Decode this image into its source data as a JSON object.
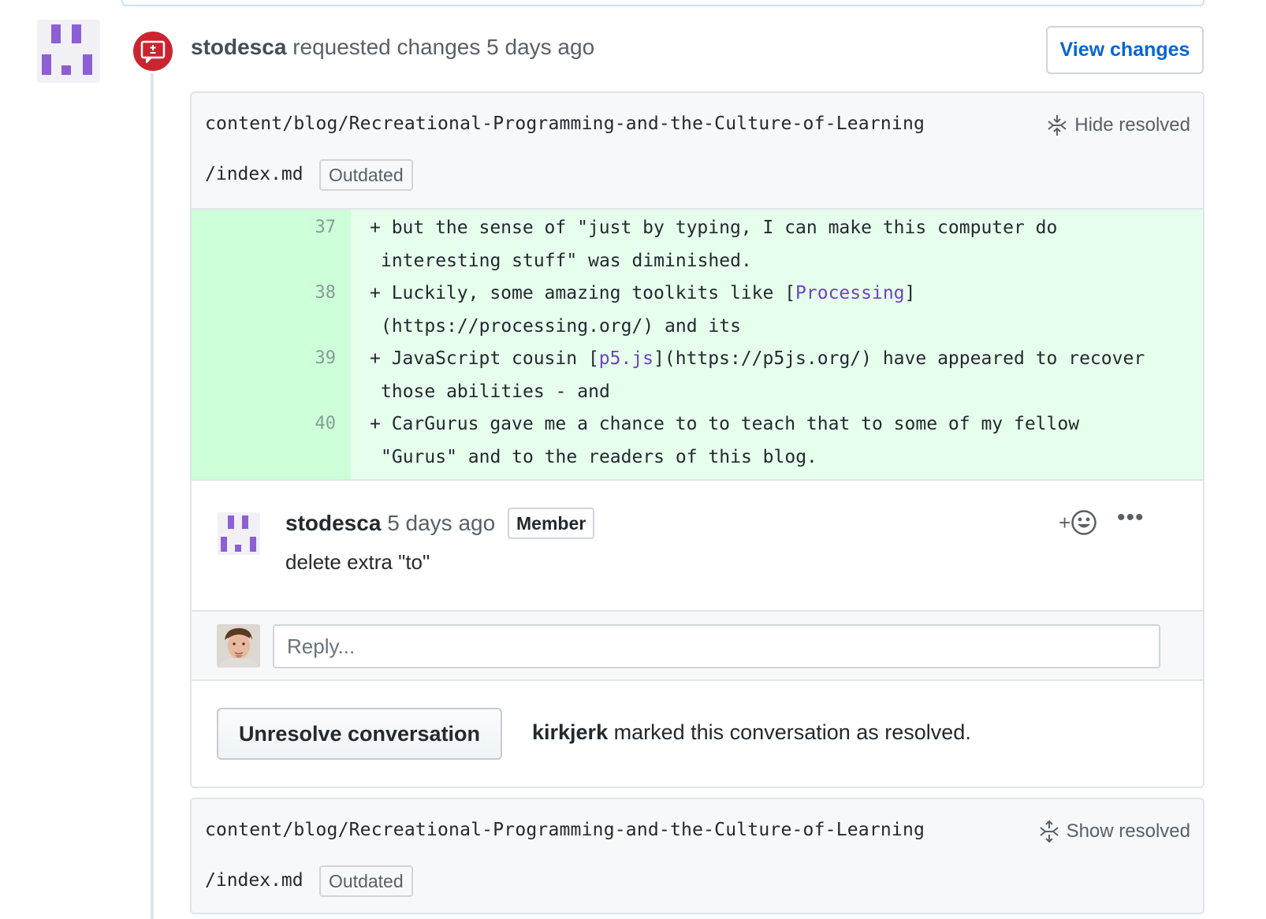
{
  "review": {
    "author": "stodesca",
    "action": "requested changes",
    "time": "5 days ago",
    "view_changes_label": "View changes"
  },
  "thread1": {
    "path_line1": "content/blog/Recreational-Programming-and-the-Culture-of-Learning",
    "path_line2": "/index.md",
    "outdated_label": "Outdated",
    "resolved_toggle_label": "Hide resolved",
    "diff_lines": [
      {
        "num": "37",
        "line1": "+ but the sense of \"just by typing, I can make this computer do",
        "line2": "interesting stuff\" was diminished."
      },
      {
        "num": "38",
        "line1_before": "+ Luckily, some amazing toolkits like [",
        "line1_link": "Processing",
        "line1_after": "]",
        "line2": "(https://processing.org/) and its"
      },
      {
        "num": "39",
        "line1_before": "+ JavaScript cousin [",
        "line1_link": "p5.js",
        "line1_after": "](https://p5js.org/) have appeared to recover",
        "line2": "those abilities - and"
      },
      {
        "num": "40",
        "line1": "+ CarGurus gave me a chance to to teach that to some of my fellow",
        "line2": "\"Gurus\" and to the readers of this blog."
      }
    ],
    "comment": {
      "author": "stodesca",
      "time": "5 days ago",
      "role": "Member",
      "body": "delete extra \"to\"",
      "more_label": "•••"
    },
    "reply_placeholder": "Reply...",
    "unresolve_label": "Unresolve conversation",
    "resolved_by": "kirkjerk",
    "resolved_text": "marked this conversation as resolved."
  },
  "thread2": {
    "path_line1": "content/blog/Recreational-Programming-and-the-Culture-of-Learning",
    "path_line2": "/index.md",
    "outdated_label": "Outdated",
    "resolved_toggle_label": "Show resolved"
  },
  "colors": {
    "link": "#0366d6",
    "changes_badge": "#cb2431",
    "diff_add_bg": "#e6ffed",
    "diff_add_gutter": "#cdffd8",
    "avatar_identicon": "#8c5fd6"
  }
}
